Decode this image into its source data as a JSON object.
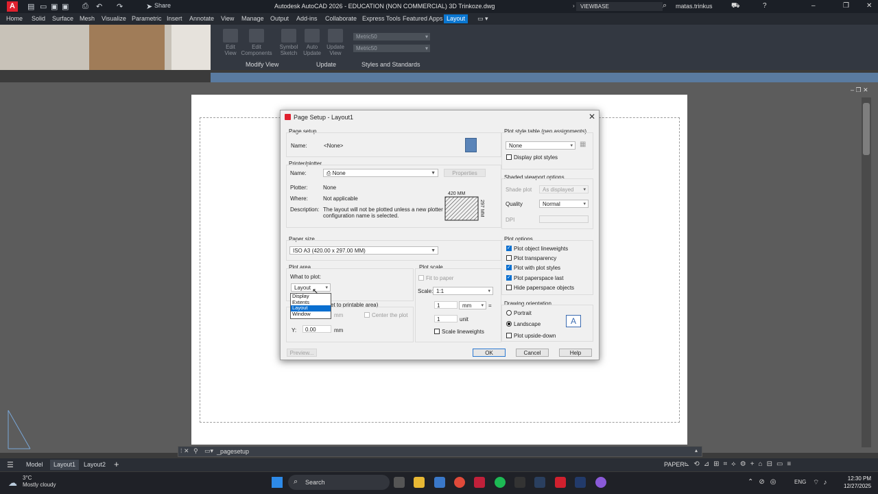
{
  "titlebar": {
    "app_letter": "A",
    "share_label": "Share",
    "title": "Autodesk AutoCAD 2026 - EDUCATION (NON COMMERCIAL)    3D Trinkoze.dwg",
    "search_text": "VIEWBASE",
    "user": "matas.trinkus"
  },
  "ribbon": {
    "tabs": [
      "Home",
      "Solid",
      "Surface",
      "Mesh",
      "Visualize",
      "Parametric",
      "Insert",
      "Annotate",
      "View",
      "Manage",
      "Output",
      "Add-ins",
      "Collaborate",
      "Express Tools",
      "Featured Apps",
      "Layout"
    ],
    "active_tab": "Layout",
    "buttons": {
      "edit_view": "Edit View",
      "edit_components": "Edit Components",
      "symbol_sketch": "Symbol Sketch",
      "auto_update": "Auto Update",
      "update_view": "Update View"
    },
    "style_combo_1": "Metric50",
    "style_combo_2": "Metric50",
    "panels": {
      "modify_view": "Modify View",
      "update": "Update",
      "styles": "Styles and Standards"
    }
  },
  "dialog": {
    "title": "Page Setup - Layout1",
    "page_setup": {
      "group": "Page setup",
      "name_label": "Name:",
      "name_value": "<None>"
    },
    "printer": {
      "group": "Printer/plotter",
      "name_label": "Name:",
      "name_value": "None",
      "properties": "Properties",
      "plotter_label": "Plotter:",
      "plotter_value": "None",
      "where_label": "Where:",
      "where_value": "Not applicable",
      "desc_label": "Description:",
      "desc_line1": "The layout will not be plotted unless a new plotter",
      "desc_line2": "configuration name is selected.",
      "preview_w": "420 MM",
      "preview_h": "297 MM"
    },
    "paper_size": {
      "group": "Paper size",
      "value": "ISO A3 (420.00 x 297.00 MM)"
    },
    "plot_area": {
      "group": "Plot area",
      "what_label": "What to plot:",
      "value": "Layout",
      "options": [
        "Display",
        "Extents",
        "Layout",
        "Window"
      ],
      "selected_index": 2,
      "offset_group": "et to printable area)",
      "x_unit": "mm",
      "center": "Center the plot",
      "y_label": "Y:",
      "y_value": "0.00",
      "y_unit": "mm"
    },
    "plot_scale": {
      "group": "Plot scale",
      "fit": "Fit to paper",
      "scale_label": "Scale:",
      "scale_value": "1:1",
      "val1": "1",
      "unit1": "mm",
      "eq": "=",
      "val2": "1",
      "unit2": "unit",
      "scale_lw": "Scale lineweights"
    },
    "pen": {
      "group": "Plot style table (pen assignments)",
      "value": "None",
      "display_styles": "Display plot styles"
    },
    "shaded": {
      "group": "Shaded viewport options",
      "shade_label": "Shade plot",
      "shade_value": "As displayed",
      "quality_label": "Quality",
      "quality_value": "Normal",
      "dpi_label": "DPI"
    },
    "plot_options": {
      "group": "Plot options",
      "items": [
        {
          "label": "Plot object lineweights",
          "checked": true
        },
        {
          "label": "Plot transparency",
          "checked": false
        },
        {
          "label": "Plot with plot styles",
          "checked": true
        },
        {
          "label": "Plot paperspace last",
          "checked": true
        },
        {
          "label": "Hide paperspace objects",
          "checked": false
        }
      ]
    },
    "orientation": {
      "group": "Drawing orientation",
      "portrait": "Portrait",
      "landscape": "Landscape",
      "upside": "Plot upside-down"
    },
    "buttons": {
      "preview": "Preview...",
      "ok": "OK",
      "cancel": "Cancel",
      "help": "Help"
    }
  },
  "command_line": "_pagesetup",
  "layout_tabs": [
    "Model",
    "Layout1",
    "Layout2"
  ],
  "active_layout": "Layout1",
  "status": {
    "paper": "PAPER"
  },
  "taskbar": {
    "temp": "3°C",
    "weather": "Mostly cloudy",
    "search": "Search",
    "lang": "ENG",
    "time": "12:30 PM",
    "date": "12/27/2025"
  }
}
